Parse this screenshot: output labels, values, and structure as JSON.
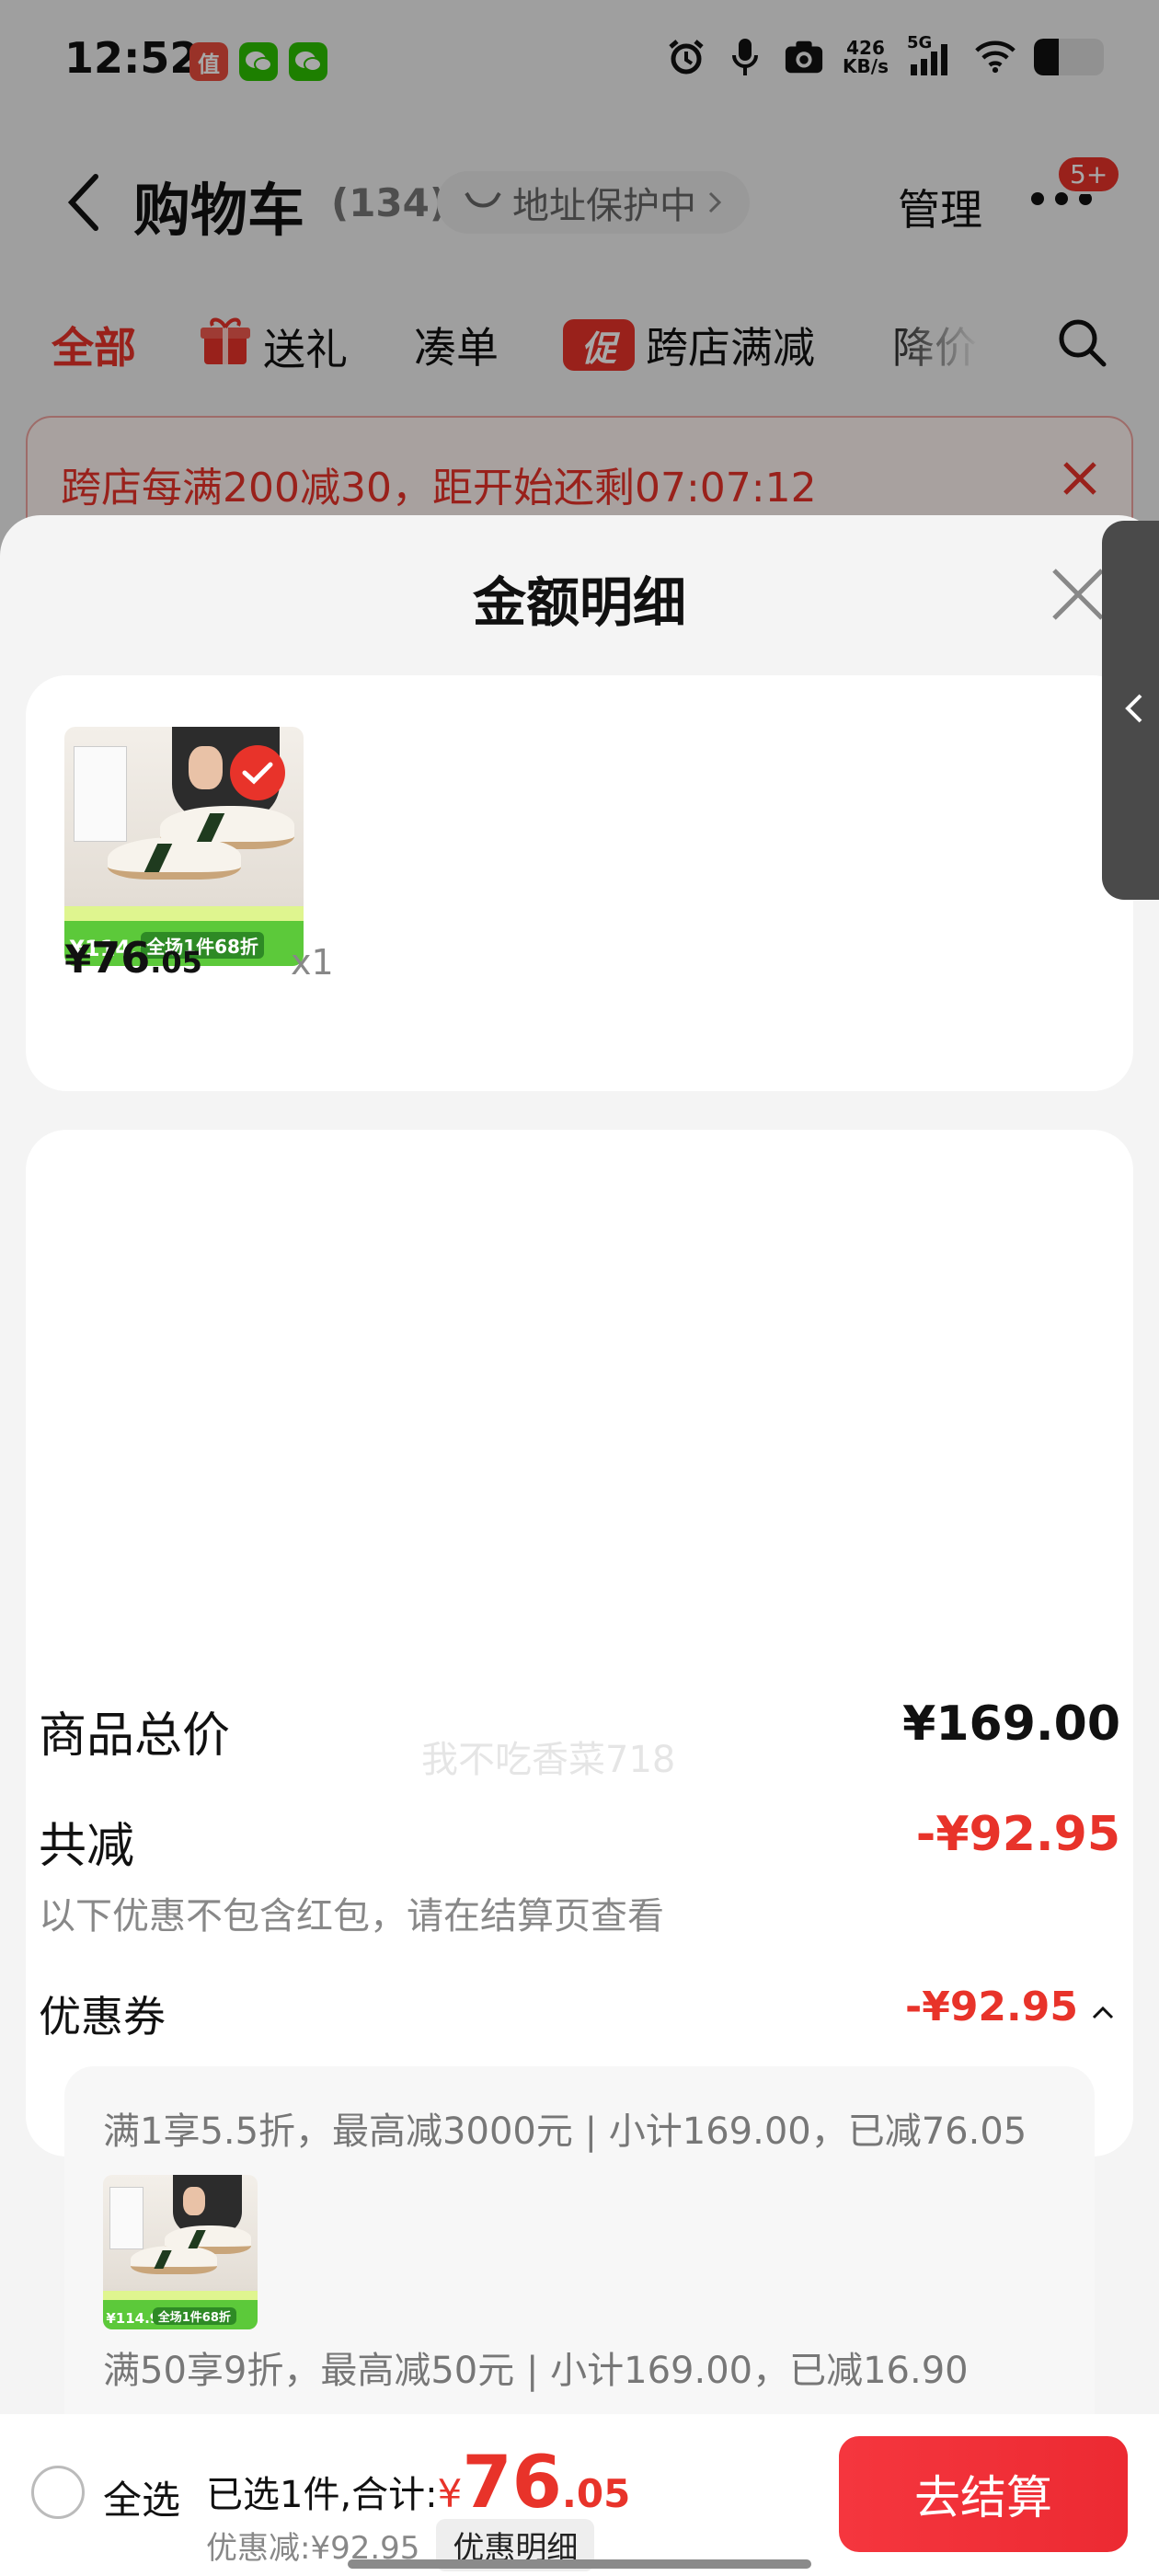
{
  "status_bar": {
    "time": "12:52",
    "apps": [
      {
        "name": "zhi-app-icon",
        "glyph": "值",
        "color": "#e84c3d"
      },
      {
        "name": "wechat-icon",
        "glyph": "",
        "color": "#2dc100"
      },
      {
        "name": "wechat-icon-2",
        "glyph": "",
        "color": "#2dc100"
      }
    ],
    "net_speed_value": "426",
    "net_speed_unit": "KB/s",
    "network": "5G",
    "battery_level": 0.35
  },
  "header": {
    "back_icon": "chevron-left-icon",
    "title": "购物车",
    "count": "(134)",
    "address_chip": "地址保护中",
    "manage": "管理",
    "more_badge": "5+"
  },
  "filters": {
    "tabs": [
      "全部",
      "送礼",
      "凑单",
      "跨店满减",
      "降价"
    ],
    "promo_glyph": "促"
  },
  "notice": {
    "text": "跨店每满200减30，距开始还剩07:07:12"
  },
  "sheet": {
    "title": "金额明细",
    "item": {
      "price_currency": "¥",
      "price_int": "76",
      "price_dec": ".05",
      "qty": "x1",
      "thumb_price": "¥114.9",
      "thumb_label": "全场1件68折"
    },
    "total_label": "商品总价",
    "total_value": "¥169.00",
    "reduce_label": "共减",
    "reduce_value": "-¥92.95",
    "reduce_note": "以下优惠不包含红包，请在结算页查看",
    "coupon_label": "优惠券",
    "coupon_value": "-¥92.95",
    "coupon_rules": [
      "满1享5.5折，最高减3000元 | 小计169.00，已减76.05",
      "满50享9折，最高减50元 | 小计169.00，已减16.90"
    ],
    "watermark": "我不吃香菜718"
  },
  "bottom_bar": {
    "select_all": "全选",
    "selected_text": "已选1件,合计:",
    "total_currency": "¥",
    "total_int": "76",
    "total_dec": ".05",
    "discount_text": "优惠减:¥92.95",
    "detail_button": "优惠明细",
    "checkout_button": "去结算"
  },
  "colors": {
    "accent": "#e8332a",
    "thumb_band": "#5cc93a"
  }
}
